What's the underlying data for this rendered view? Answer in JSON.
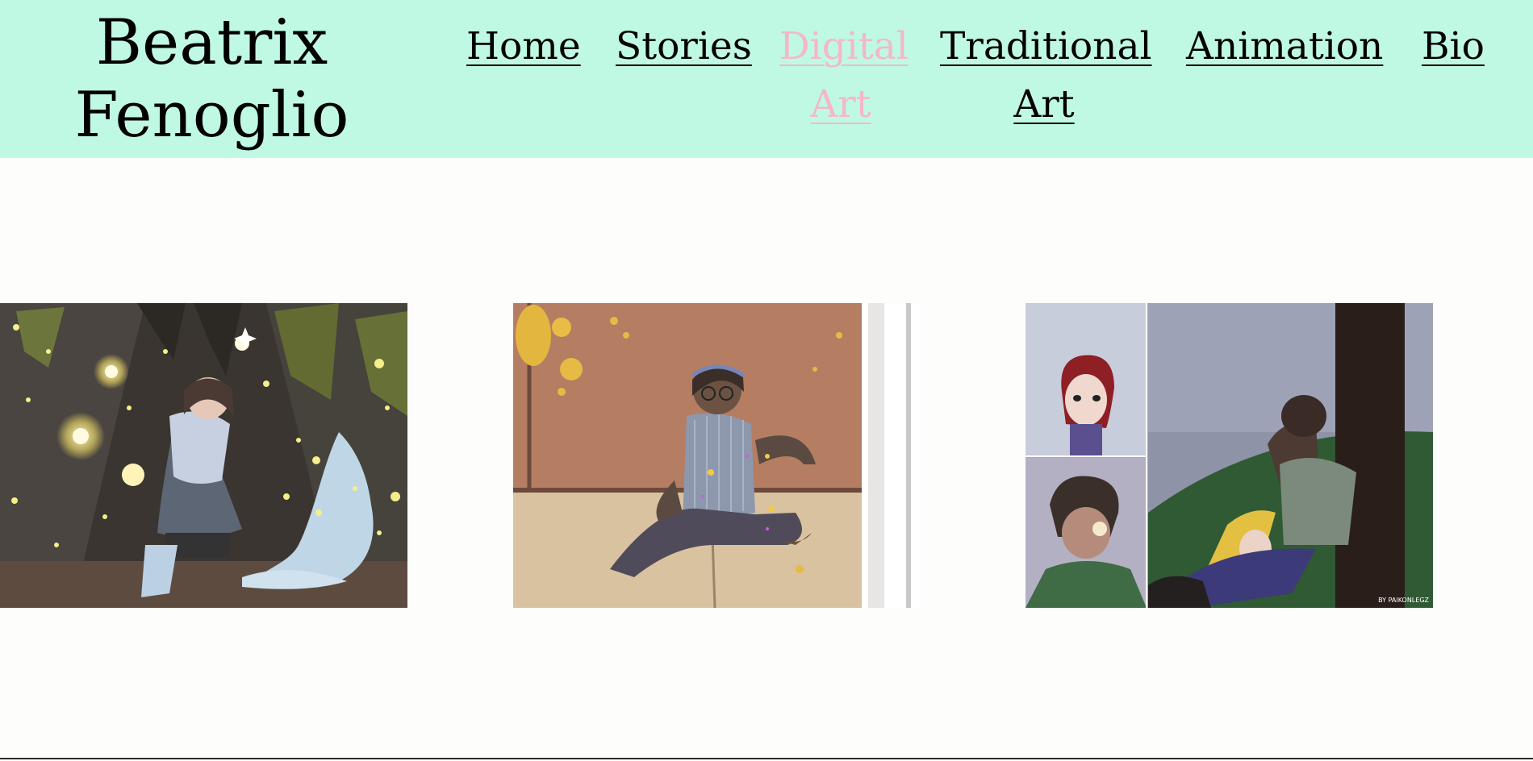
{
  "site": {
    "title_line1": "Beatrix",
    "title_line2": "Fenoglio"
  },
  "nav": {
    "home": "Home",
    "stories": "Stories",
    "digital_line1": "Digital",
    "digital_line2": "Art",
    "traditional_line1": "Traditional",
    "traditional_line2": "Art",
    "animation": "Animation",
    "bio": "Bio",
    "active": "Digital Art"
  },
  "colors": {
    "header_bg": "#bff9e4",
    "active_link": "#f4b8c8",
    "page_bg": "#fdfdfc"
  },
  "gallery": {
    "images": [
      {
        "subject": "girl with lantern in firefly cave by waterfall"
      },
      {
        "subject": "girl with glasses sitting on floor in warm light"
      },
      {
        "subject": "comic panels: red-haired girl, boy with glasses, couple under tree",
        "signature": "BY PAIKONLEGZ"
      }
    ]
  }
}
